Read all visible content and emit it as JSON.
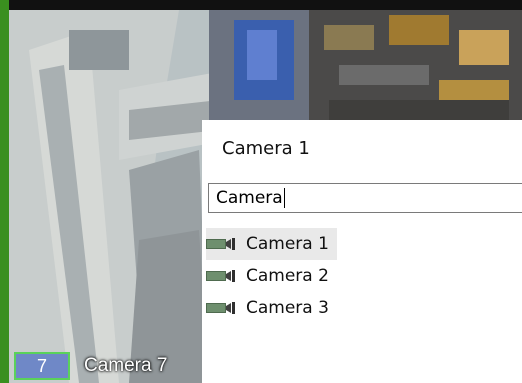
{
  "video_tile": {
    "camera_number": "7",
    "camera_name": "Camera 7",
    "accent_color": "#5ad25a",
    "badge_color": "#6f88c7",
    "frame_color": "#3a8f1f"
  },
  "camera_picker": {
    "current_camera": "Camera 1",
    "search_value": "Camera",
    "results": [
      {
        "label": "Camera 1",
        "icon": "camera-icon",
        "selected": true
      },
      {
        "label": "Camera 2",
        "icon": "camera-icon",
        "selected": false
      },
      {
        "label": "Camera 3",
        "icon": "camera-icon",
        "selected": false
      }
    ]
  }
}
